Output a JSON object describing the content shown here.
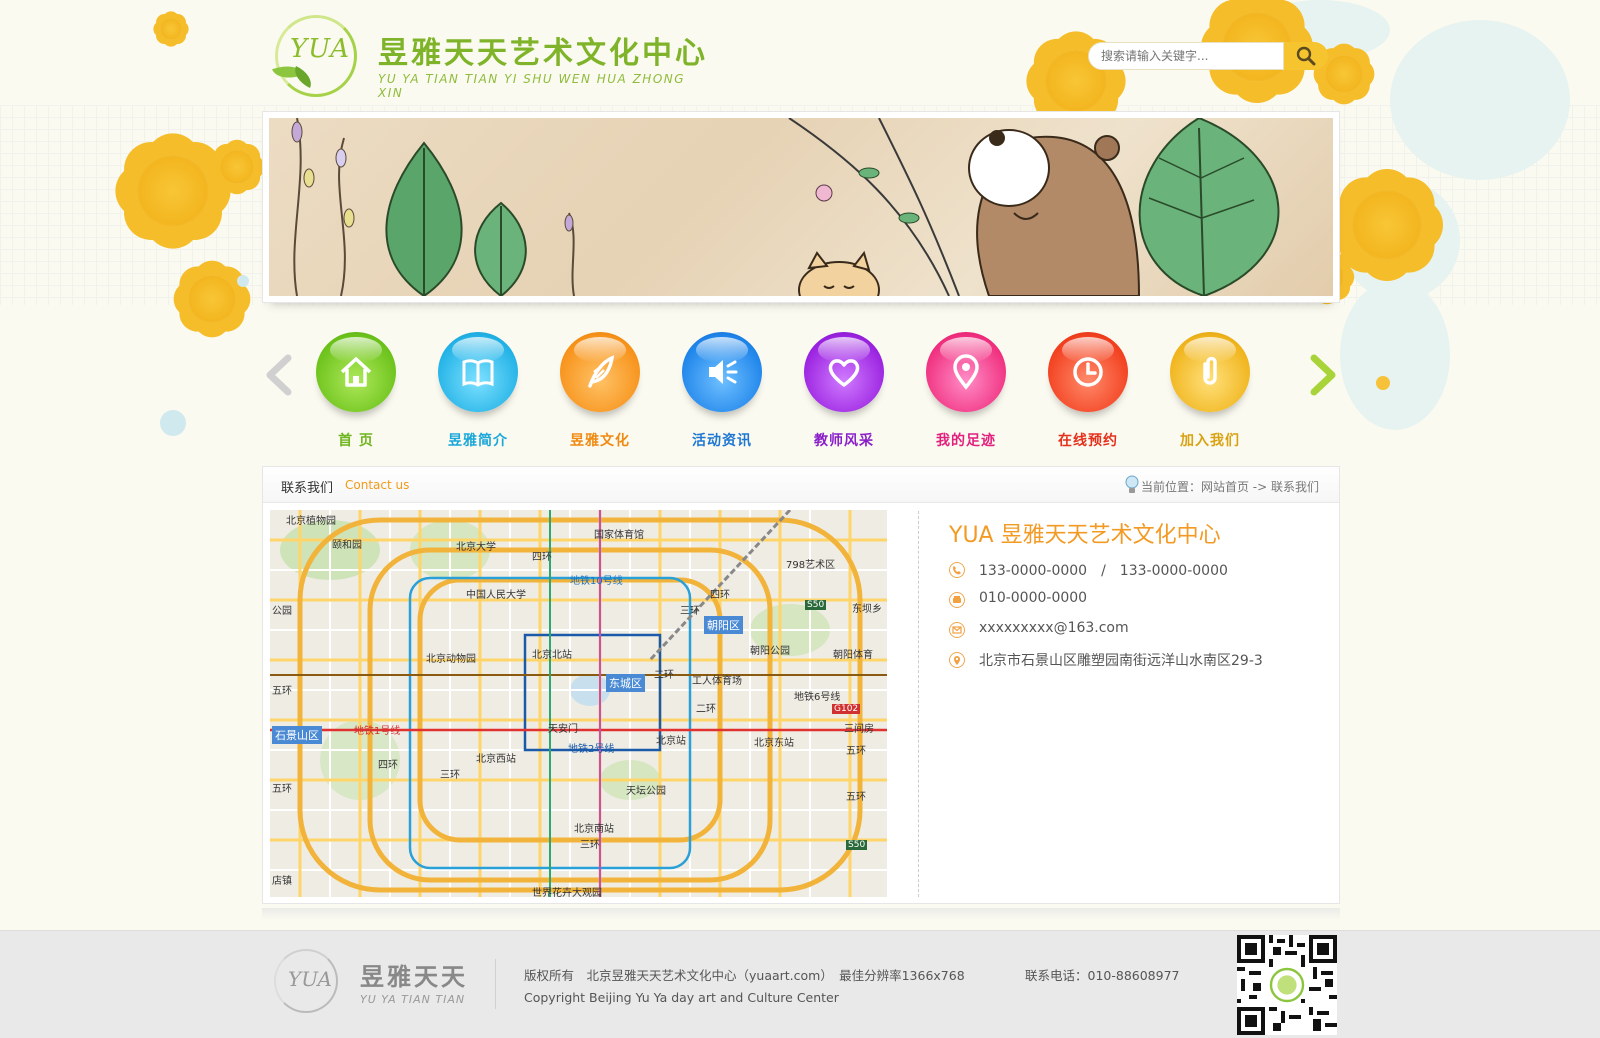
{
  "header": {
    "logo_mark": "YUA",
    "logo_cn": "昱雅天天艺术文化中心",
    "logo_en": "YU YA TIAN TIAN YI SHU WEN HUA ZHONG XIN",
    "search_placeholder": "搜索请输入关键字..."
  },
  "nav": {
    "items": [
      {
        "label": "首 页",
        "color": "#6fb51f",
        "ball": "#8fd63a",
        "icon": "home-icon"
      },
      {
        "label": "昱雅简介",
        "color": "#1aa7d9",
        "ball": "#36c3ee",
        "icon": "book-icon"
      },
      {
        "label": "昱雅文化",
        "color": "#f08a12",
        "ball": "#f79d1f",
        "icon": "feather-icon"
      },
      {
        "label": "活动资讯",
        "color": "#1e78d2",
        "ball": "#2f8ff0",
        "icon": "speaker-icon"
      },
      {
        "label": "教师风采",
        "color": "#8a1fc9",
        "ball": "#a230e6",
        "icon": "heart-icon"
      },
      {
        "label": "我的足迹",
        "color": "#e2207e",
        "ball": "#f53b99",
        "icon": "location-pin-icon"
      },
      {
        "label": "在线预约",
        "color": "#e5301c",
        "ball": "#f64a2c",
        "icon": "clock-icon"
      },
      {
        "label": "加入我们",
        "color": "#d9a212",
        "ball": "#f0bd27",
        "icon": "paperclip-icon"
      }
    ]
  },
  "panel": {
    "title": "联系我们",
    "title_en": "Contact us",
    "breadcrumb": "当前位置：网站首页 -> 联系我们"
  },
  "map": {
    "labels": {
      "l1": "北京植物园",
      "l2": "颐和园",
      "l3": "北京大学",
      "l4": "国家体育馆",
      "l5": "四环",
      "l6": "798艺术区",
      "l7": "地铁10号线",
      "l8": "中国人民大学",
      "l9": "四环",
      "l10": "三环",
      "l11": "朝阳区",
      "l12": "S50",
      "l13": "东坝乡",
      "l14": "公园",
      "l15": "北京动物园",
      "l16": "北京北站",
      "l17": "朝阳公园",
      "l18": "朝阳体育",
      "l19": "东城区",
      "l20": "工人体育场",
      "l21": "二环",
      "l22": "五环",
      "l23": "地铁6号线",
      "l24": "G102",
      "l25": "石景山区",
      "l26": "地铁1号线",
      "l27": "天安门",
      "l28": "北京站",
      "l29": "北京东站",
      "l30": "三间房",
      "l31": "地铁2号线",
      "l32": "北京西站",
      "l33": "五环",
      "l34": "四环",
      "l35": "三环",
      "l36": "天坛公园",
      "l37": "北京南站",
      "l38": "三环",
      "l39": "S50",
      "l40": "店镇",
      "l41": "世界花卉大观园",
      "l42": "五环",
      "l43": "二环",
      "l44": "五环"
    }
  },
  "contact": {
    "org_name": "YUA 昱雅天天艺术文化中心",
    "mobile": "133-0000-0000　/　133-0000-0000",
    "phone": "010-0000-0000",
    "email": "xxxxxxxxx@163.com",
    "address": "北京市石景山区雕塑园南街远洋山水南区29-3"
  },
  "footer": {
    "logo_mark": "YUA",
    "logo_cn": "昱雅天天",
    "logo_en": "YU YA TIAN TIAN",
    "copyright_cn": "版权所有　北京昱雅天天艺术文化中心（yuaart.com）　最佳分辨率1366x768",
    "phone": "联系电话：010-88608977",
    "copyright_en": "Copyright Beijing Yu Ya day art and Culture Center"
  }
}
